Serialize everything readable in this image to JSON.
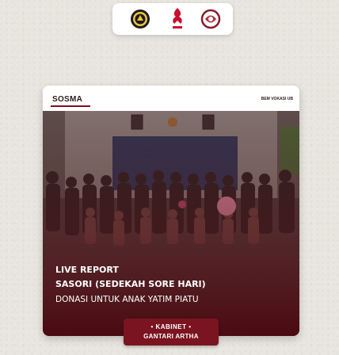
{
  "post": {
    "department": "SOSMA",
    "organization": "BEM VOKASI UB",
    "headline_1": "LIVE REPORT",
    "headline_2": "SASORI (SEDEKAH SORE HARI)",
    "headline_3": "DONASI UNTUK ANAK YATIM PIATU"
  },
  "badge": {
    "line1": "• KABINET •",
    "line2": "GANTARI ARTHA"
  },
  "logos": [
    "university-seal-icon",
    "bem-logo-icon",
    "cabinet-logo-icon"
  ],
  "colors": {
    "accent": "#7a1420",
    "background": "#e9e6e0",
    "card": "#ffffff"
  }
}
